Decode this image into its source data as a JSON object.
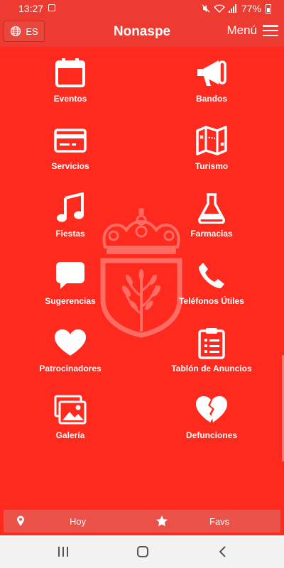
{
  "status_bar": {
    "time": "13:27",
    "battery": "77%"
  },
  "header": {
    "language": "ES",
    "title": "Nonaspe",
    "menu_label": "Menú"
  },
  "tiles": [
    {
      "label": "Eventos",
      "icon": "calendar-icon"
    },
    {
      "label": "Bandos",
      "icon": "megaphone-icon"
    },
    {
      "label": "Servicios",
      "icon": "credit-card-icon"
    },
    {
      "label": "Turismo",
      "icon": "map-icon"
    },
    {
      "label": "Fiestas",
      "icon": "music-note-icon"
    },
    {
      "label": "Farmacias",
      "icon": "flask-icon"
    },
    {
      "label": "Sugerencias",
      "icon": "speech-bubble-icon"
    },
    {
      "label": "Teléfonos Útiles",
      "icon": "phone-icon"
    },
    {
      "label": "Patrocinadores",
      "icon": "heart-icon"
    },
    {
      "label": "Tablón de Anuncios",
      "icon": "clipboard-icon"
    },
    {
      "label": "Galería",
      "icon": "gallery-icon"
    },
    {
      "label": "Defunciones",
      "icon": "broken-heart-icon"
    }
  ],
  "tab_bar": {
    "today": "Hoy",
    "favorites": "Favs"
  },
  "colors": {
    "background": "#fe2a1e",
    "header": "#ee3b31",
    "tab_bar": "#ea5149"
  }
}
